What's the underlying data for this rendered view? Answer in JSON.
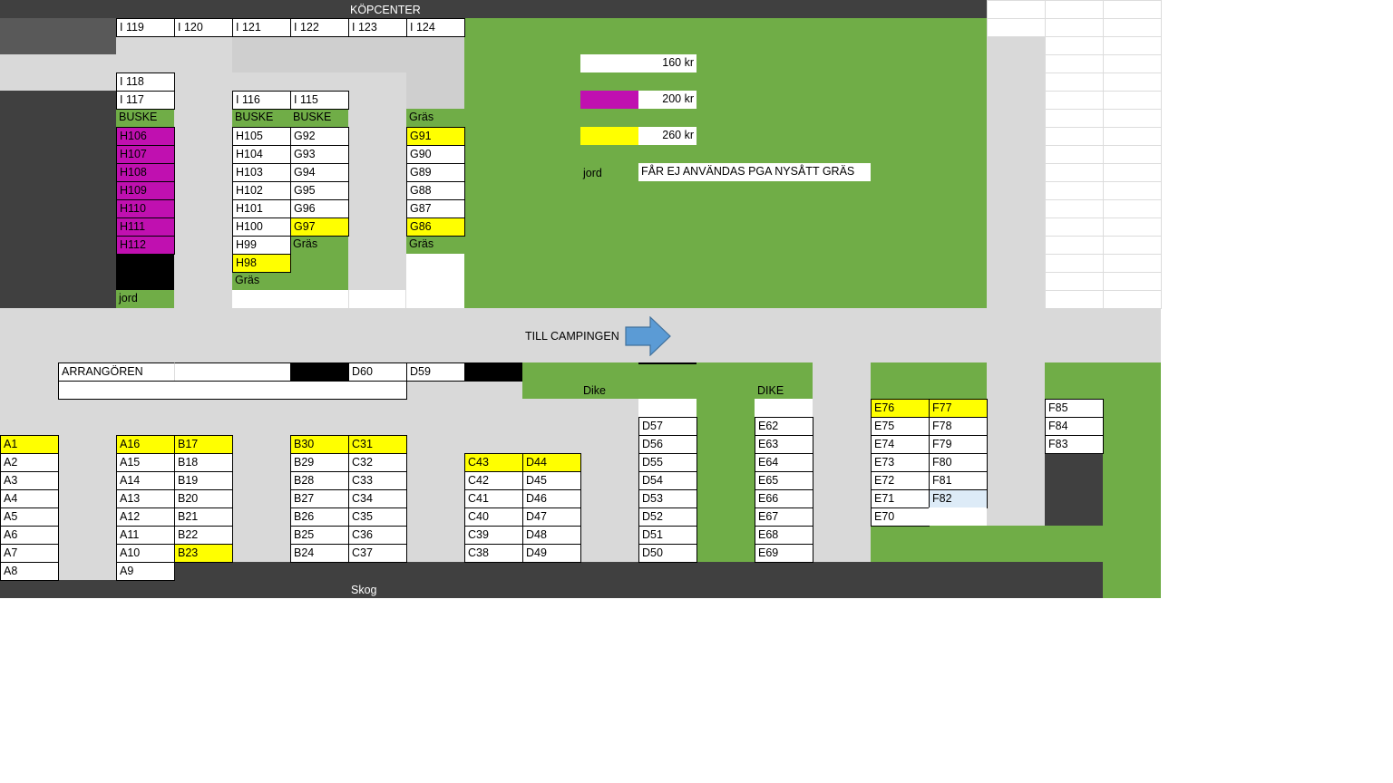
{
  "colors": {
    "road": "#d9d9d9",
    "grass": "#70ad47",
    "dark": "#404040",
    "corner_dark": "#595959",
    "black": "#000000",
    "white": "#ffffff",
    "yellow": "#ffff00",
    "magenta": "#c010b0",
    "selected": "#ddebf7",
    "arrow": "#5b9bd5"
  },
  "labels": {
    "kopcenter": "KÖPCENTER",
    "till_campingen": "TILL CAMPINGEN",
    "skog": "Skog",
    "dike_left": "Dike",
    "dike_right": "DIKE",
    "arrangoren": "ARRANGÖREN",
    "buske_1": "BUSKE",
    "buske_2": "BUSKE",
    "buske_3": "BUSKE",
    "gras_g": "Gräs",
    "gras_g97": "Gräs",
    "gras_g86": "Gräs",
    "gras_h": "Gräs",
    "jord_h": "jord"
  },
  "legend": {
    "price_160": "160 kr",
    "price_200": "200 kr",
    "price_260": "260 kr",
    "jord_label": "jord",
    "jord_note": "FÅR EJ ANVÄNDAS PGA NYSÅTT GRÄS"
  },
  "plots": {
    "i_row": [
      "I 119",
      "I 120",
      "I 121",
      "I 122",
      "I 123",
      "I 124"
    ],
    "i_118": "I 118",
    "i_117": "I 117",
    "i_116": "I 116",
    "i_115": "I 115",
    "h_left": [
      "H106",
      "H107",
      "H108",
      "H109",
      "H110",
      "H111",
      "H112"
    ],
    "h_mid": [
      "H105",
      "H104",
      "H103",
      "H102",
      "H101",
      "H100",
      "H99",
      "H98"
    ],
    "g_mid": [
      "G92",
      "G93",
      "G94",
      "G95",
      "G96",
      "G97"
    ],
    "g_right": [
      "G91",
      "G90",
      "G89",
      "G88",
      "G87",
      "G86"
    ],
    "d_top": [
      "D60",
      "D59"
    ],
    "a_left": [
      "A1",
      "A2",
      "A3",
      "A4",
      "A5",
      "A6",
      "A7",
      "A8"
    ],
    "a_right": [
      "A16",
      "A15",
      "A14",
      "A13",
      "A12",
      "A11",
      "A10",
      "A9"
    ],
    "b_left": [
      "B17",
      "B18",
      "B19",
      "B20",
      "B21",
      "B22",
      "B23"
    ],
    "b_right": [
      "B30",
      "B29",
      "B28",
      "B27",
      "B26",
      "B25",
      "B24"
    ],
    "c_31": [
      "C31",
      "C32",
      "C33",
      "C34",
      "C35",
      "C36",
      "C37"
    ],
    "c_43": [
      "C43",
      "C42",
      "C41",
      "C40",
      "C39",
      "C38"
    ],
    "d_44": [
      "D44",
      "D45",
      "D46",
      "D47",
      "D48",
      "D49"
    ],
    "d_57": [
      "D57",
      "D56",
      "D55",
      "D54",
      "D53",
      "D52",
      "D51",
      "D50"
    ],
    "e_62": [
      "E62",
      "E63",
      "E64",
      "E65",
      "E66",
      "E67",
      "E68",
      "E69"
    ],
    "e_76": [
      "E76",
      "E75",
      "E74",
      "E73",
      "E72",
      "E71",
      "E70"
    ],
    "f_77": [
      "F77",
      "F78",
      "F79",
      "F80",
      "F81",
      "F82"
    ],
    "f_85": [
      "F85",
      "F84",
      "F83"
    ]
  },
  "yellow_plots": [
    "G91",
    "G97",
    "G86",
    "H98",
    "A1",
    "A16",
    "B17",
    "B23",
    "B30",
    "C31",
    "C43",
    "D44",
    "E76",
    "F77"
  ],
  "magenta_plots": [
    "H106",
    "H107",
    "H108",
    "H109",
    "H110",
    "H111",
    "H112"
  ],
  "selected_plot": "F82"
}
